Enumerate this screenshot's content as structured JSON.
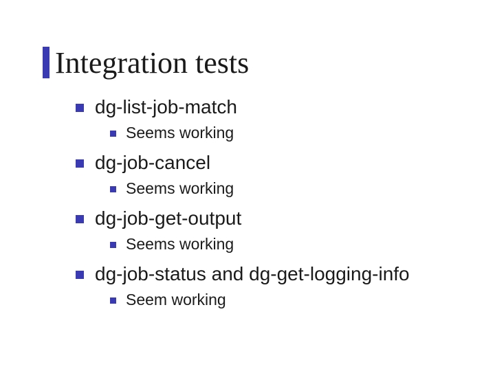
{
  "title": "Integration tests",
  "items": [
    {
      "label": "dg-list-job-match",
      "sub": "Seems working"
    },
    {
      "label": "dg-job-cancel",
      "sub": "Seems working"
    },
    {
      "label": "dg-job-get-output",
      "sub": "Seems working"
    },
    {
      "label": "dg-job-status and dg-get-logging-info",
      "sub": "Seem working"
    }
  ]
}
